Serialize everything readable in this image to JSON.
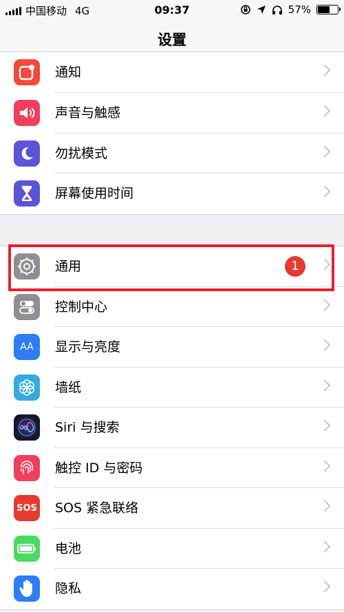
{
  "status": {
    "carrier": "中国移动",
    "network": "4G",
    "time": "09:37",
    "battery": "57%",
    "battery_level": 0.57
  },
  "nav": {
    "title": "设置"
  },
  "group1": [
    {
      "label": "通知",
      "icon": "notifications-icon",
      "color": "#f04a3d"
    },
    {
      "label": "声音与触感",
      "icon": "speaker-icon",
      "color": "#f03f5c"
    },
    {
      "label": "勿扰模式",
      "icon": "moon-icon",
      "color": "#5b55d6"
    },
    {
      "label": "屏幕使用时间",
      "icon": "hourglass-icon",
      "color": "#5b55d6"
    }
  ],
  "group2": [
    {
      "label": "通用",
      "icon": "gear-icon",
      "color": "#8e8e93",
      "badge": "1"
    },
    {
      "label": "控制中心",
      "icon": "toggles-icon",
      "color": "#8e8e93"
    },
    {
      "label": "显示与亮度",
      "icon": "display-icon",
      "color": "#2f7cf6",
      "glyph": "AA"
    },
    {
      "label": "墙纸",
      "icon": "wallpaper-flower-icon",
      "color": "#35aadc"
    },
    {
      "label": "Siri 与搜索",
      "icon": "siri-icon",
      "color": "#1b1b3a"
    },
    {
      "label": "触控 ID 与密码",
      "icon": "fingerprint-icon",
      "color": "#f03f5c"
    },
    {
      "label": "SOS 紧急联络",
      "icon": "sos-icon",
      "color": "#e53c2f",
      "glyph": "SOS"
    },
    {
      "label": "电池",
      "icon": "battery-icon",
      "color": "#4cd964"
    },
    {
      "label": "隐私",
      "icon": "hand-icon",
      "color": "#2f7cf6"
    }
  ]
}
